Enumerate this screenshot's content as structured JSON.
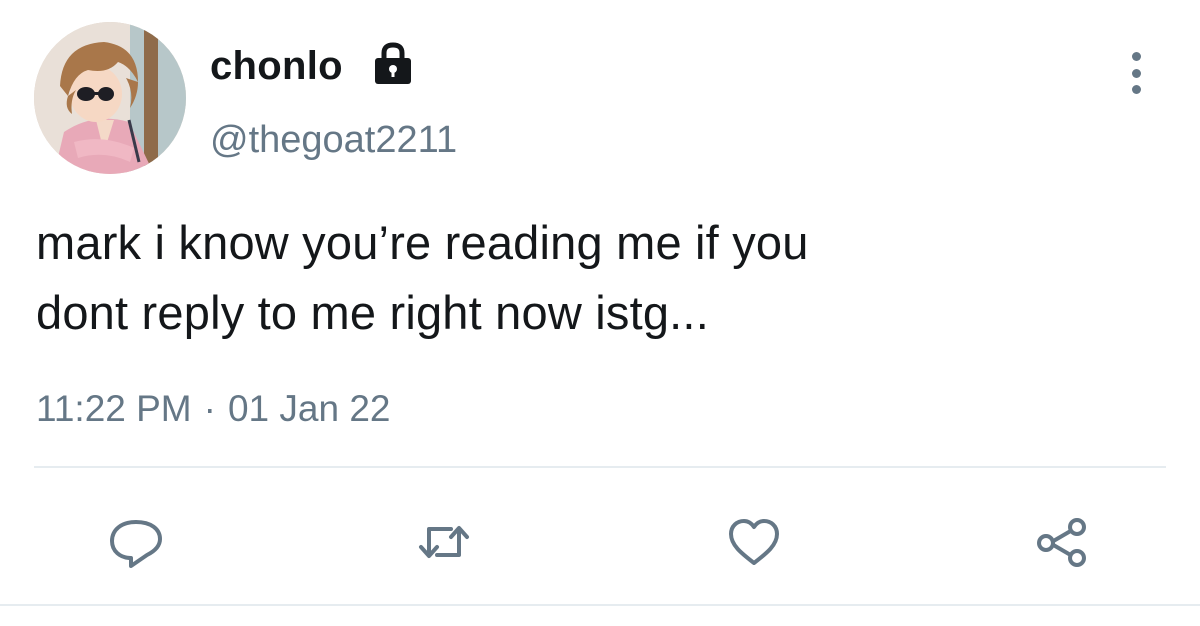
{
  "user": {
    "display_name": "chonlo",
    "handle": "@thegoat2211",
    "protected_icon": "lock-icon",
    "avatar": "avatar-image"
  },
  "tweet": {
    "text_lines": [
      "mark i know you’re reading me if you",
      "dont reply to me right now istg..."
    ],
    "time": "11:22 PM",
    "separator": "·",
    "date": "01 Jan 22"
  },
  "actions": {
    "more": "more-options-icon",
    "reply": "reply-icon",
    "retweet": "retweet-icon",
    "like": "heart-icon",
    "share": "share-icon"
  },
  "colors": {
    "text": "#14171a",
    "secondary": "#657786",
    "divider": "#e6ecf0"
  }
}
